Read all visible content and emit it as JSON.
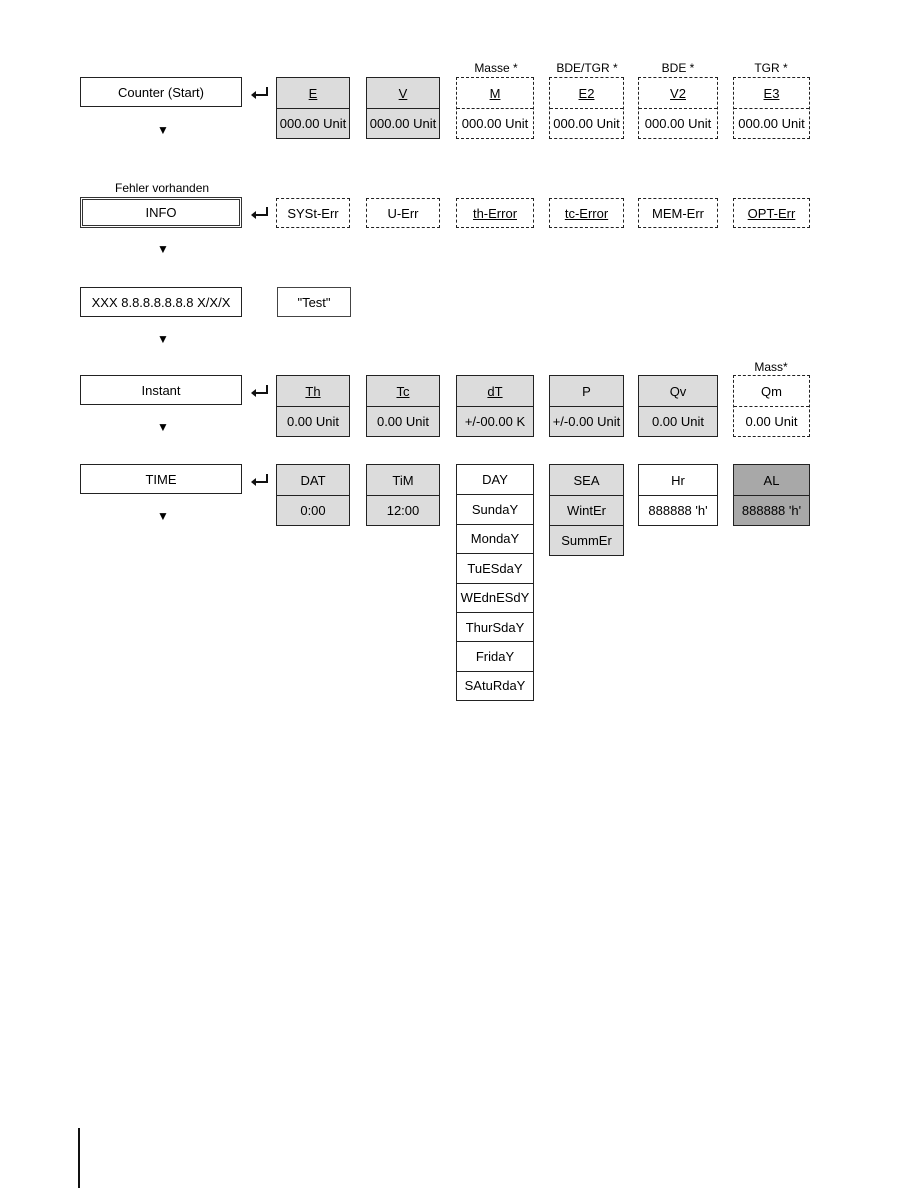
{
  "rows": {
    "counter": {
      "label": "Counter (Start)",
      "items": [
        {
          "title": "E",
          "value": "000.00 Unit",
          "caption": ""
        },
        {
          "title": "V",
          "value": "000.00 Unit",
          "caption": ""
        },
        {
          "title": "M",
          "value": "000.00 Unit",
          "caption": "Masse *"
        },
        {
          "title": "E2",
          "value": "000.00 Unit",
          "caption": "BDE/TGR *"
        },
        {
          "title": "V2",
          "value": "000.00 Unit",
          "caption": "BDE *"
        },
        {
          "title": "E3",
          "value": "000.00 Unit",
          "caption": "TGR *"
        }
      ]
    },
    "info": {
      "caption": "Fehler vorhanden",
      "label": "INFO",
      "items": [
        "SYSt-Err",
        "U-Err",
        "th-Error",
        "tc-Error",
        "MEM-Err",
        "OPT-Err"
      ]
    },
    "version": {
      "label": "XXX 8.8.8.8.8.8.8 X/X/X",
      "items": [
        "\"Test\""
      ]
    },
    "instant": {
      "label": "Instant",
      "items": [
        {
          "title": "Th",
          "value": "0.00 Unit",
          "caption": ""
        },
        {
          "title": "Tc",
          "value": "0.00 Unit",
          "caption": ""
        },
        {
          "title": "dT",
          "value": "+/-00.00 K",
          "caption": ""
        },
        {
          "title": "P",
          "value": "+/-0.00 Unit",
          "caption": ""
        },
        {
          "title": "Qv",
          "value": "0.00 Unit",
          "caption": ""
        },
        {
          "title": "Qm",
          "value": "0.00 Unit",
          "caption": "Mass*"
        }
      ]
    },
    "time": {
      "label": "TIME",
      "dat": {
        "title": "DAT",
        "value": "0:00"
      },
      "tim": {
        "title": "TiM",
        "value": "12:00"
      },
      "day": {
        "title": "DAY",
        "options": [
          "SundaY",
          "MondaY",
          "TuESdaY",
          "WEdnESdY",
          "ThurSdaY",
          "FridaY",
          "SAtuRdaY"
        ]
      },
      "sea": {
        "title": "SEA",
        "options": [
          "WintEr",
          "SummEr"
        ]
      },
      "hr": {
        "title": "Hr",
        "value": "888888 'h'"
      },
      "al": {
        "title": "AL",
        "value": "888888 'h'"
      }
    }
  },
  "icons": {
    "next": "down-triangle-icon",
    "enter": "enter-return-icon"
  },
  "colors": {
    "light_fill": "#dcdcdc",
    "dark_fill": "#a8a8a8",
    "border": "#222222"
  }
}
